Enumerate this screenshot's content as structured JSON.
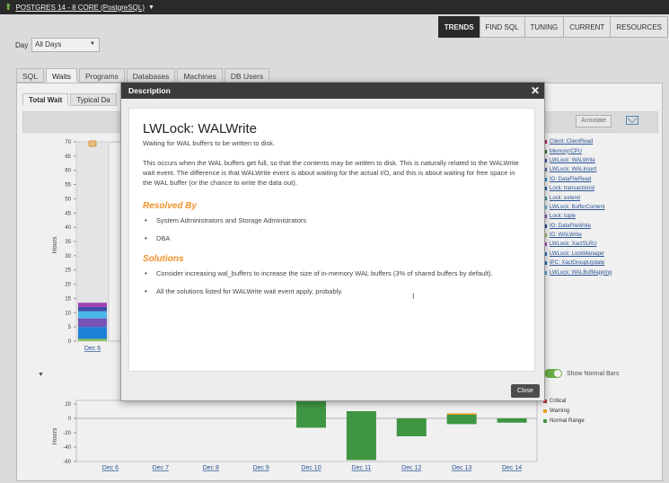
{
  "topbar": {
    "title": "POSTGRES 14 - 8 CORE (PostgreSQL)"
  },
  "main_nav": [
    {
      "label": "TRENDS",
      "active": true
    },
    {
      "label": "FIND SQL",
      "active": false
    },
    {
      "label": "TUNING",
      "active": false
    },
    {
      "label": "CURRENT",
      "active": false
    },
    {
      "label": "RESOURCES",
      "active": false
    }
  ],
  "filter": {
    "day_label": "Day",
    "day_value": "All Days"
  },
  "sub_tabs": [
    {
      "label": "SQL",
      "active": false
    },
    {
      "label": "Waits",
      "active": true
    },
    {
      "label": "Programs",
      "active": false
    },
    {
      "label": "Databases",
      "active": false
    },
    {
      "label": "Machines",
      "active": false
    },
    {
      "label": "DB Users",
      "active": false
    }
  ],
  "wait_tabs": [
    {
      "label": "Total Wait",
      "active": true
    },
    {
      "label": "Typical Da",
      "active": false
    }
  ],
  "toolbar": {
    "annotate_label": "Annotate"
  },
  "legend_top": [
    {
      "label": "Client: ClientRead",
      "color": "#c2185b"
    },
    {
      "label": "Memory/CPU",
      "color": "#2e7d32"
    },
    {
      "label": "LWLock: WALWrite",
      "color": "#3f51b5"
    },
    {
      "label": "LWLock: WALInsert",
      "color": "#5c6bc0"
    },
    {
      "label": "IO: DataFileRead",
      "color": "#1e88e5"
    },
    {
      "label": "Lock: transactionid",
      "color": "#1565c0"
    },
    {
      "label": "Lock: extend",
      "color": "#26a69a"
    },
    {
      "label": "LWLock: BufferContent",
      "color": "#4fc3f7"
    },
    {
      "label": "Lock: tuple",
      "color": "#7e57c2"
    },
    {
      "label": "IO: DataFileWrite",
      "color": "#0d47a1"
    },
    {
      "label": "IO: WALWrite",
      "color": "#9ccc65"
    },
    {
      "label": "LWLock: XactSLRU",
      "color": "#ab47bc"
    },
    {
      "label": "LWLock: LockManager",
      "color": "#1976d2"
    },
    {
      "label": "IPC: XactGroupUpdate",
      "color": "#0277bd"
    },
    {
      "label": "LWLock: WALBufMapping",
      "color": "#42a5f5"
    }
  ],
  "toggle": {
    "label": "Show Normal Bars"
  },
  "legend_bottom": [
    {
      "label": "Critical",
      "color": "#d32f2f"
    },
    {
      "label": "Warning",
      "color": "#f9a825"
    },
    {
      "label": "Normal Range",
      "color": "#43a047"
    }
  ],
  "chart_data": [
    {
      "type": "bar",
      "ylabel": "Hours",
      "ylim": [
        0,
        70
      ],
      "yticks": [
        0,
        5,
        10,
        15,
        20,
        25,
        30,
        35,
        40,
        45,
        50,
        55,
        60,
        65,
        70
      ],
      "categories": [
        "Dec 6"
      ],
      "stacked_series": [
        {
          "name": "IO: WALWrite",
          "color": "#9ccc65",
          "values": [
            0.8
          ]
        },
        {
          "name": "IO: DataFileRead",
          "color": "#1e88e5",
          "values": [
            4.2
          ]
        },
        {
          "name": "Lock: tuple",
          "color": "#7e57c2",
          "values": [
            3.0
          ]
        },
        {
          "name": "LWLock: BufferContent",
          "color": "#4fc3f7",
          "values": [
            2.5
          ]
        },
        {
          "name": "LWLock: WALWrite",
          "color": "#3f51b5",
          "values": [
            1.5
          ]
        },
        {
          "name": "LWLock: XactSLRU",
          "color": "#ab47bc",
          "values": [
            1.5
          ]
        }
      ],
      "legend": "right"
    },
    {
      "type": "bar",
      "ylabel": "Hours",
      "ylim": [
        -60,
        25
      ],
      "yticks": [
        20,
        0,
        -20,
        -40,
        -60
      ],
      "categories": [
        "Dec 6",
        "Dec 7",
        "Dec 8",
        "Dec 9",
        "Dec 10",
        "Dec 11",
        "Dec 12",
        "Dec 13",
        "Dec 14"
      ],
      "series": [
        {
          "name": "Normal Range",
          "color": "#43a047",
          "bars": [
            null,
            null,
            null,
            null,
            [
              -13,
              24
            ],
            [
              -58,
              10
            ],
            [
              -25,
              0
            ],
            [
              -8,
              6
            ],
            [
              -6,
              0
            ]
          ]
        },
        {
          "name": "Warning",
          "color": "#f9a825",
          "bars": [
            null,
            null,
            null,
            null,
            null,
            null,
            null,
            [
              5,
              7
            ],
            null
          ]
        }
      ],
      "legend": "right"
    }
  ],
  "modal": {
    "header_title": "Description",
    "wait_name": "LWLock: WALWrite",
    "subtitle": "Waiting for WAL buffers to be written to disk.",
    "description": "This occurs when the WAL buffers get full, so that the contents may be written to disk. This is naturally related to the WALWrite wait event. The difference is that WALWrite event is about waiting for the actual I/O, and this is about waiting for free space in the WAL buffer (or the chance to write the data out).",
    "resolved_by_title": "Resolved By",
    "resolved_by": [
      "System Administrators and Storage Administrators",
      "DBA"
    ],
    "solutions_title": "Solutions",
    "solutions": [
      "Consider increasing wal_buffers to increase the size of in-memory WAL buffers (3% of shared buffers by default).",
      "All the solutions listed for WALWrite wait event apply, probably."
    ],
    "close_label": "Close"
  }
}
